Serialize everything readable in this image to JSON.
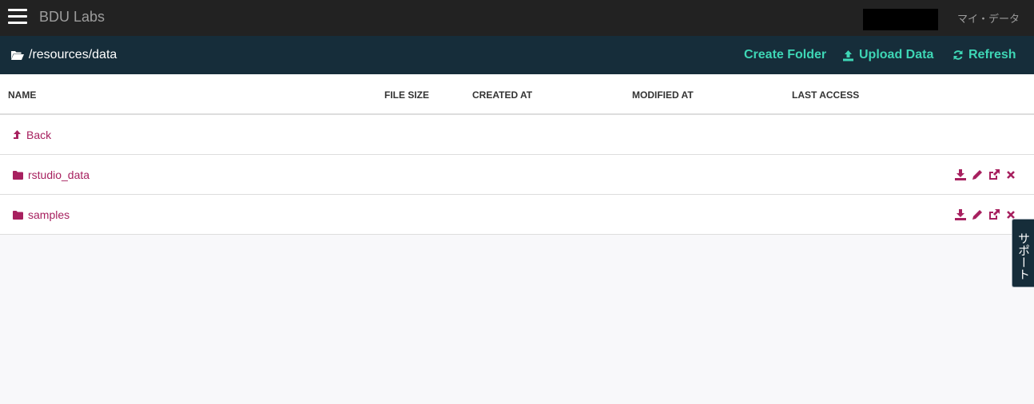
{
  "header": {
    "brand": "BDU Labs",
    "my_data_link": "マイ・データ"
  },
  "pathbar": {
    "current_path": "/resources/data",
    "actions": {
      "create_folder": "Create Folder",
      "upload_data": "Upload Data",
      "refresh": "Refresh"
    }
  },
  "table": {
    "columns": [
      "NAME",
      "FILE SIZE",
      "CREATED AT",
      "MODIFIED AT",
      "LAST ACCESS"
    ],
    "back_label": "Back",
    "rows": [
      {
        "name": "rstudio_data",
        "type": "folder"
      },
      {
        "name": "samples",
        "type": "folder"
      }
    ]
  },
  "support_tab": "サポート",
  "colors": {
    "topbar": "#222222",
    "pathbar": "#162d3a",
    "accent": "#3ed6b5",
    "link": "#a7205f"
  },
  "icons": {
    "row_actions": [
      "download-icon",
      "pencil-icon",
      "share-icon",
      "close-icon"
    ]
  }
}
